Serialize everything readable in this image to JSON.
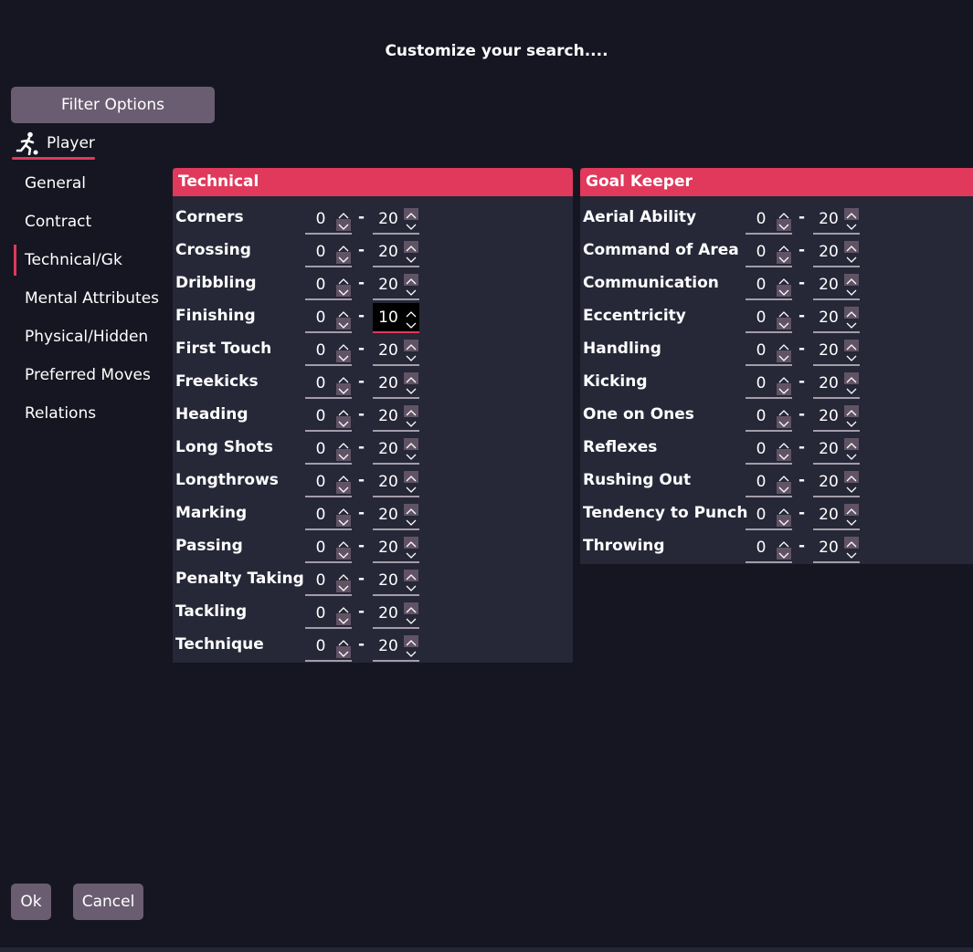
{
  "dialog": {
    "title": "Customize your search....",
    "filter_options_label": "Filter Options",
    "player_tab_label": "Player"
  },
  "nav": {
    "items": [
      {
        "label": "General",
        "active": false
      },
      {
        "label": "Contract",
        "active": false
      },
      {
        "label": "Technical/Gk",
        "active": true
      },
      {
        "label": "Mental Attributes",
        "active": false
      },
      {
        "label": "Physical/Hidden",
        "active": false
      },
      {
        "label": "Preferred Moves",
        "active": false
      },
      {
        "label": "Relations",
        "active": false
      }
    ]
  },
  "technical": {
    "title": "Technical",
    "range_separator": "-",
    "rows": [
      {
        "label": "Corners",
        "min": "0",
        "max": "20"
      },
      {
        "label": "Crossing",
        "min": "0",
        "max": "20"
      },
      {
        "label": "Dribbling",
        "min": "0",
        "max": "20"
      },
      {
        "label": "Finishing",
        "min": "0",
        "max": "10",
        "max_focused": true
      },
      {
        "label": "First Touch",
        "min": "0",
        "max": "20"
      },
      {
        "label": "Freekicks",
        "min": "0",
        "max": "20"
      },
      {
        "label": "Heading",
        "min": "0",
        "max": "20"
      },
      {
        "label": "Long Shots",
        "min": "0",
        "max": "20"
      },
      {
        "label": "Longthrows",
        "min": "0",
        "max": "20"
      },
      {
        "label": "Marking",
        "min": "0",
        "max": "20"
      },
      {
        "label": "Passing",
        "min": "0",
        "max": "20"
      },
      {
        "label": "Penalty Taking",
        "min": "0",
        "max": "20"
      },
      {
        "label": "Tackling",
        "min": "0",
        "max": "20"
      },
      {
        "label": "Technique",
        "min": "0",
        "max": "20"
      }
    ]
  },
  "goalkeeper": {
    "title": "Goal Keeper",
    "range_separator": "-",
    "rows": [
      {
        "label": "Aerial Ability",
        "min": "0",
        "max": "20"
      },
      {
        "label": "Command of Area",
        "min": "0",
        "max": "20"
      },
      {
        "label": "Communication",
        "min": "0",
        "max": "20"
      },
      {
        "label": "Eccentricity",
        "min": "0",
        "max": "20"
      },
      {
        "label": "Handling",
        "min": "0",
        "max": "20"
      },
      {
        "label": "Kicking",
        "min": "0",
        "max": "20"
      },
      {
        "label": "One on Ones",
        "min": "0",
        "max": "20"
      },
      {
        "label": "Reflexes",
        "min": "0",
        "max": "20"
      },
      {
        "label": "Rushing Out",
        "min": "0",
        "max": "20"
      },
      {
        "label": "Tendency to Punch",
        "min": "0",
        "max": "20"
      },
      {
        "label": "Throwing",
        "min": "0",
        "max": "20"
      }
    ]
  },
  "actions": {
    "ok_label": "Ok",
    "cancel_label": "Cancel"
  },
  "icons": {
    "player": "player-kicking-icon",
    "spin_up": "chevron-up-icon",
    "spin_down": "chevron-down-icon"
  },
  "colors": {
    "background": "#151621",
    "panel": "#262737",
    "accent": "#e0395c",
    "button": "#6a5d71",
    "spin_disabled": "#615366",
    "underline": "#a39cab"
  }
}
